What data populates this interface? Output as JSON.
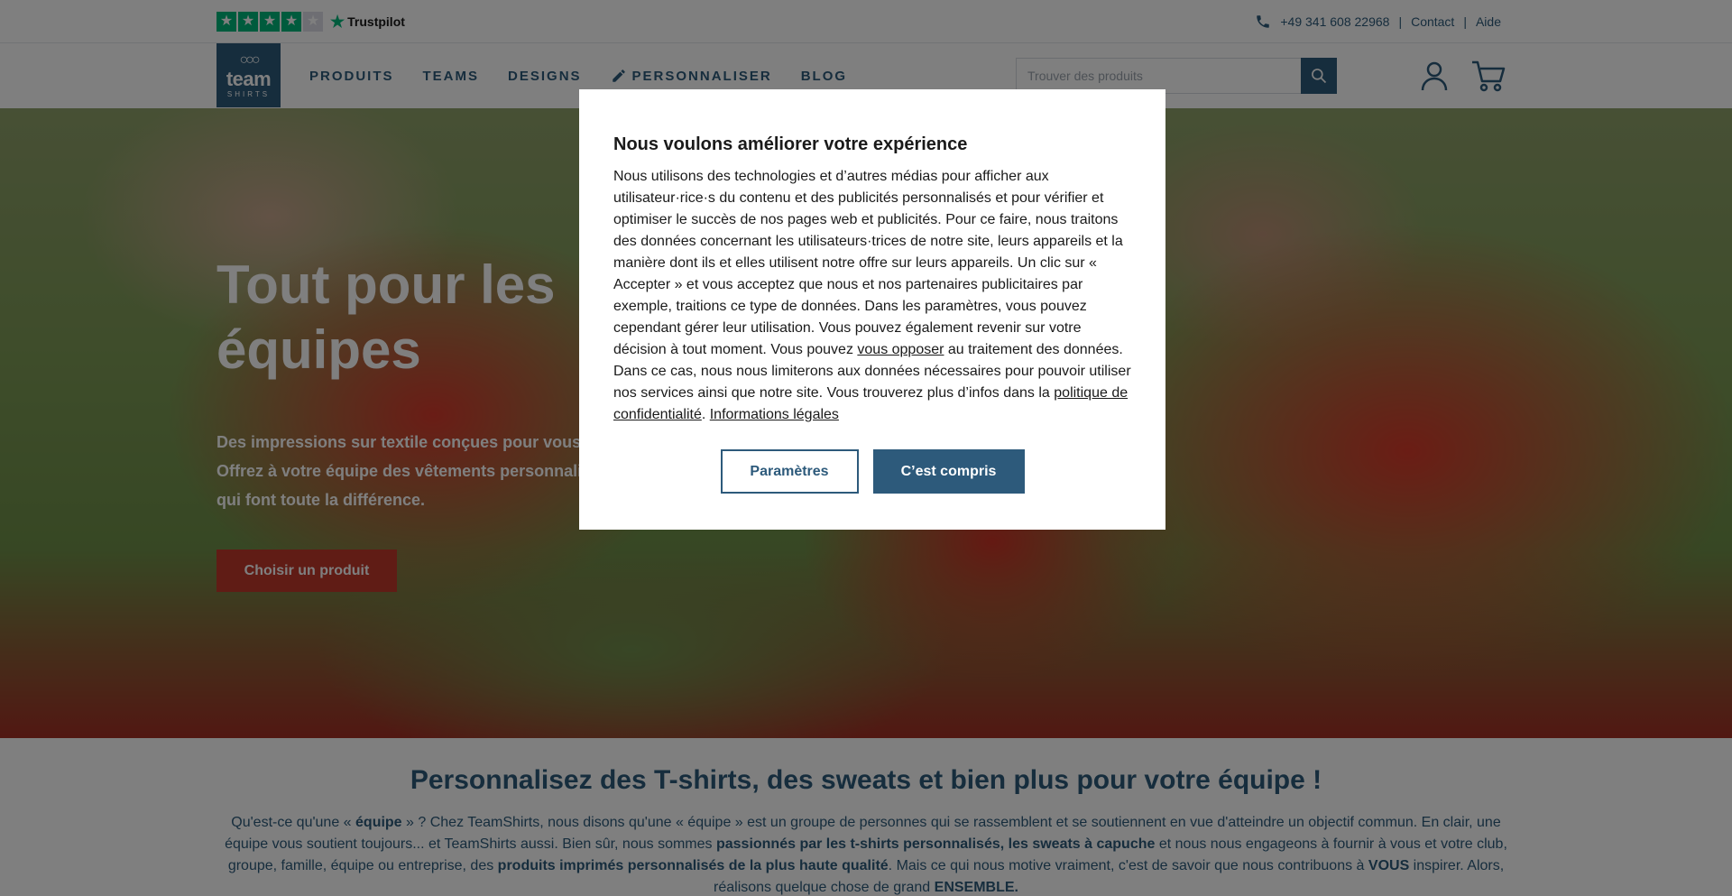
{
  "topbar": {
    "trustpilot_label": "Trustpilot",
    "rating_stars": 4,
    "rating_max": 5,
    "phone": "+49 341 608 22968",
    "separator": "|",
    "contact": "Contact",
    "help": "Aide"
  },
  "header": {
    "logo_line1": "team",
    "logo_line2": "SHIRTS",
    "nav": {
      "products": "PRODUITS",
      "teams": "TEAMS",
      "designs": "DESIGNS",
      "customize": "PERSONNALISER",
      "blog": "BLOG"
    },
    "search_placeholder": "Trouver des produits"
  },
  "hero": {
    "title_line1": "Tout pour les",
    "title_line2": "équipes",
    "sub_line1": "Des impressions sur textile conçues pour vous.",
    "sub_line2": "Offrez à votre équipe des vêtements personnalisés",
    "sub_line3": "qui font toute la différence.",
    "cta": "Choisir un produit"
  },
  "intro": {
    "title": "Personnalisez des T-shirts, des sweats et bien plus pour votre équipe !",
    "p1": "Qu'est-ce qu'une « ",
    "b1": "équipe",
    "p2": " » ? Chez TeamShirts, nous disons qu'une « équipe » est un groupe de personnes qui se rassemblent et se soutiennent en vue d'atteindre un objectif commun. En clair, une équipe vous soutient toujours... et TeamShirts aussi. Bien sûr, nous sommes ",
    "b2": "passionnés par les t-shirts personnalisés, les sweats à capuche",
    "p3": " et nous nous engageons à fournir à vous et votre club, groupe, famille, équipe ou entreprise, des ",
    "b3": "produits imprimés personnalisés de la plus haute qualité",
    "p4": ". Mais ce qui nous motive vraiment, c'est de savoir que nous contribuons à ",
    "b4": "VOUS",
    "p5": " inspirer. Alors, réalisons quelque chose de grand ",
    "b5": "ENSEMBLE."
  },
  "consent": {
    "title": "Nous voulons améliorer votre expérience",
    "body1": "Nous utilisons des technologies et d’autres médias pour afficher aux utilisateur·rice·s du contenu et des publicités personnalisés et pour vérifier et optimiser le succès de nos pages web et publicités. Pour ce faire, nous traitons des données concernant les utilisateurs·trices de notre site, leurs appareils et la manière dont ils et elles utilisent notre offre sur leurs appareils. Un clic sur « Accepter » et vous acceptez que nous et nos partenaires publicitaires par exemple, traitions ce type de données. Dans les paramètres, vous pouvez cependant gérer leur utilisation. Vous pouvez également revenir sur votre décision à tout moment. Vous pouvez ",
    "link_object": "vous opposer",
    "body2": " au traitement des données. Dans ce cas, nous nous limiterons aux données nécessaires pour pouvoir utiliser nos services ainsi que notre site. Vous trouverez plus d’infos dans la ",
    "link_privacy": "politique de confidentialité",
    "body3": ". ",
    "link_legal": "Informations légales",
    "btn_settings": "Paramètres",
    "btn_accept": "C’est compris"
  },
  "colors": {
    "brand": "#2d5a7b",
    "cta": "#c0392b",
    "trustpilot": "#00b67a"
  }
}
